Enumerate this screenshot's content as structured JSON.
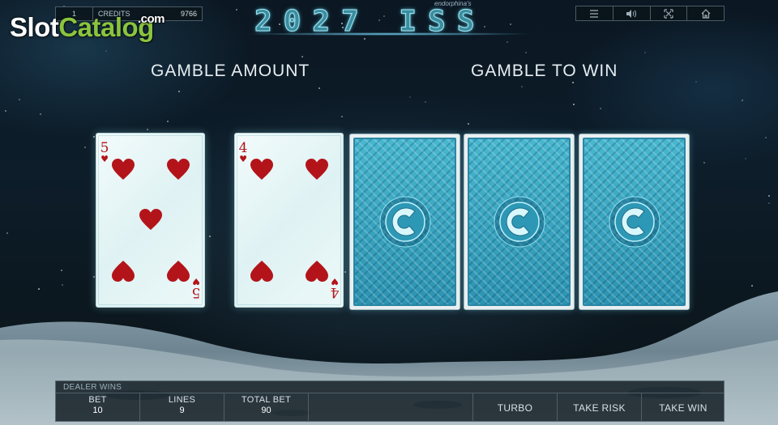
{
  "top_bar": {
    "lines": "1",
    "credits_label": "CREDITS",
    "credits_value": "9766"
  },
  "watermark": {
    "slot": "Slot",
    "catalog": "Catalog",
    "dotcom": ".com"
  },
  "logo": {
    "title": "2027 ISS",
    "brand": "endorphina's"
  },
  "toolbar": {
    "icons": [
      "menu-icon",
      "sound-icon",
      "fullscreen-icon",
      "home-icon"
    ]
  },
  "headings": {
    "gamble_amount": "GAMBLE AMOUNT",
    "gamble_to_win": "GAMBLE TO WIN"
  },
  "cards": {
    "dealer": {
      "rank": "5",
      "suit": "♥",
      "color": "#b3141a"
    },
    "player": {
      "rank": "4",
      "suit": "♥",
      "color": "#b3141a"
    },
    "face_down_count": 3
  },
  "bottom": {
    "status": "DEALER WINS",
    "bet_label": "BET",
    "bet_value": "10",
    "lines_label": "LINES",
    "lines_value": "9",
    "total_bet_label": "TOTAL BET",
    "total_bet_value": "90",
    "turbo": "TURBO",
    "take_risk": "TAKE RISK",
    "take_win": "TAKE WIN"
  },
  "colors": {
    "accent_cyan": "#3b8d9e",
    "card_back": "#48b7cf",
    "heart_red": "#b3141a"
  }
}
